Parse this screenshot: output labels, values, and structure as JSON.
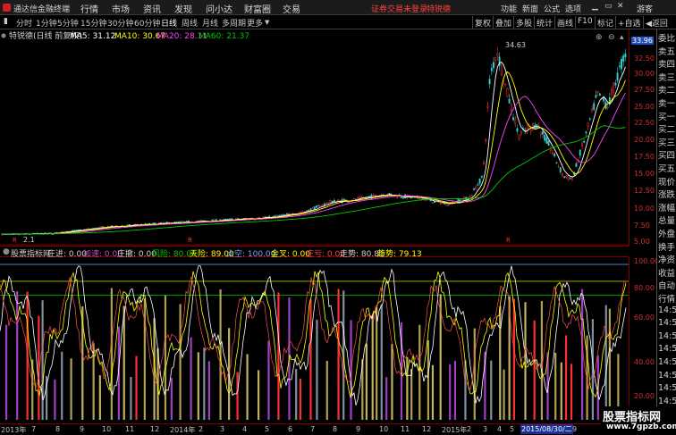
{
  "menubar": {
    "app_title": "通达信金融终端",
    "menus": [
      "行情",
      "市场",
      "资讯",
      "发现",
      "问小达",
      "财富圈",
      "交易"
    ],
    "notice": "证券交易未登录",
    "stock_link": "特锐德",
    "right_menus": [
      "功能",
      "新面",
      "公式",
      "选项"
    ],
    "guest": "游客"
  },
  "toolbar": {
    "periods": [
      "分时",
      "1分钟",
      "5分钟",
      "15分钟",
      "30分钟",
      "60分钟",
      "日线",
      "周线",
      "月线",
      "多周期",
      "更多"
    ],
    "active_period": "日线",
    "buttons": [
      "复权",
      "叠加",
      "多股",
      "统计",
      "画线",
      "F10",
      "标记",
      "+自选",
      "◀返回"
    ]
  },
  "main_chart": {
    "title": "特锐德(日线 前复权)",
    "ma_legend": [
      {
        "label": "MA5: 31.12",
        "color": "#ffffff"
      },
      {
        "label": "MA10: 30.67",
        "color": "#ffff00"
      },
      {
        "label": "MA20: 28.11",
        "color": "#ff44ff"
      },
      {
        "label": "MA60: 21.37",
        "color": "#00cc00"
      }
    ],
    "y_ticks": [
      "32.50",
      "30.00",
      "27.50",
      "25.00",
      "22.50",
      "20.00",
      "17.50",
      "15.00",
      "12.50",
      "10.00",
      "7.50",
      "5.00"
    ],
    "current_price": "33.96",
    "high_label": "34.63",
    "low_label": "2.1",
    "marker": "R"
  },
  "indicator_bar": {
    "name": "股票指标网",
    "items": [
      {
        "label": "庄进: 0.00",
        "color": "#d0d0d0"
      },
      {
        "label": "加速: 0.00",
        "color": "#c050c0"
      },
      {
        "label": "庄撤: 0.00",
        "color": "#d0d0d0"
      },
      {
        "label": "风险: 80.00",
        "color": "#00cc00"
      },
      {
        "label": "天险: 89.00",
        "color": "#ffff00"
      },
      {
        "label": "太空: 100.00",
        "color": "#6fa8ff"
      },
      {
        "label": "金叉: 0.00",
        "color": "#ffff00"
      },
      {
        "label": "庄亏: 0.00",
        "color": "#ff4040"
      },
      {
        "label": "走势: 80.81",
        "color": "#d0d0d0"
      },
      {
        "label": "趋势: 79.13",
        "color": "#ffff00"
      }
    ]
  },
  "sub_chart": {
    "y_ticks": [
      "100.00",
      "80.00",
      "60.00",
      "40.00",
      "20.00"
    ]
  },
  "date_axis": {
    "labels": [
      "2013年",
      "7",
      "8",
      "9",
      "10",
      "11",
      "12",
      "2014年",
      "2",
      "3",
      "4",
      "5",
      "6",
      "7",
      "8",
      "9",
      "10",
      "11",
      "12",
      "2015年",
      "2",
      "3",
      "4",
      "5",
      "6",
      "7",
      "2015/08/30/二",
      "9"
    ]
  },
  "right_panel": {
    "items": [
      "委比",
      "卖五",
      "卖四",
      "卖三",
      "卖二",
      "卖一",
      "买一",
      "买二",
      "买三",
      "买四",
      "买五",
      "现价",
      "涨跌",
      "涨幅",
      "总量",
      "外盘",
      "换手",
      "净资",
      "收益",
      "自动",
      "行情",
      "14:5",
      "14:5",
      "14:5",
      "14:5",
      "14:5",
      "14:5",
      "14:5",
      "14:5",
      "14:5",
      "14:5"
    ]
  },
  "watermark": {
    "name": "股票指标网",
    "url": "www.7gpzb.com"
  }
}
